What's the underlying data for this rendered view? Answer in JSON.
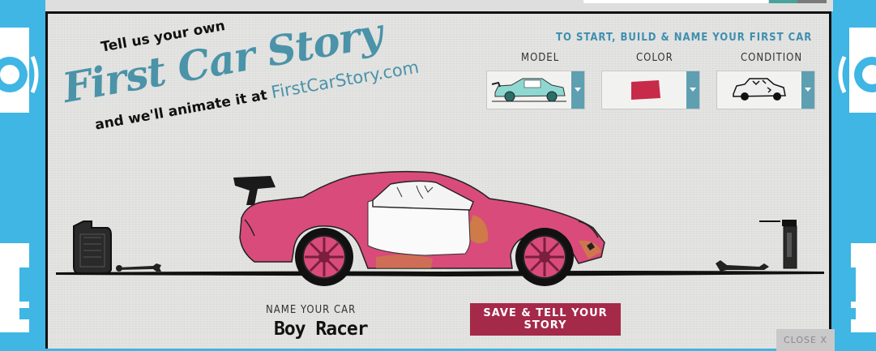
{
  "header": {
    "line1": "Tell us your own",
    "line2": "First Car Story",
    "line3": "and we'll animate it at",
    "site": "FirstCarStory.com"
  },
  "builder": {
    "title": "TO START, BUILD & NAME YOUR FIRST CAR",
    "model_label": "MODEL",
    "color_label": "COLOR",
    "condition_label": "CONDITION"
  },
  "colors": {
    "page_bg": "#3fb6e4",
    "accent": "#4a93a8",
    "car_body": "#d94b7a",
    "button": "#a52a4a",
    "dropdown_arrow": "#5e9fb2"
  },
  "form": {
    "name_label": "NAME YOUR CAR",
    "car_name": "Boy Racer",
    "save_label": "SAVE & TELL YOUR STORY",
    "close_label": "CLOSE X"
  }
}
